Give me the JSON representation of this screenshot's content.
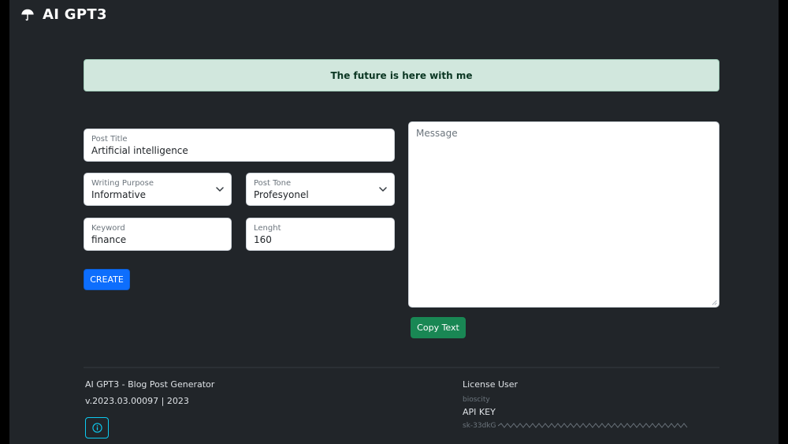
{
  "header": {
    "title": "AI GPT3",
    "logo_icon": "umbrella-icon"
  },
  "banner": {
    "text": "The future is here with me"
  },
  "form": {
    "post_title": {
      "label": "Post Title",
      "value": "Artificial intelligence"
    },
    "writing_purpose": {
      "label": "Writing Purpose",
      "value": "Informative"
    },
    "post_tone": {
      "label": "Post Tone",
      "value": "Profesyonel"
    },
    "keyword": {
      "label": "Keyword",
      "value": "finance"
    },
    "length": {
      "label": "Lenght",
      "value": "160"
    },
    "create_label": "CREATE"
  },
  "output": {
    "placeholder": "Message",
    "copy_label": "Copy Text"
  },
  "footer": {
    "app_name": "AI GPT3 - Blog Post Generator",
    "version": "v.2023.03.00097 | 2023",
    "license_label": "License User",
    "license_user": "bioscity",
    "api_key_label": "API KEY",
    "api_key_value": "sk-33dkG"
  },
  "colors": {
    "primary": "#0d6efd",
    "success": "#198754",
    "info": "#0dcaf0",
    "banner_bg": "#d1e7dd",
    "banner_text": "#0a3622"
  }
}
